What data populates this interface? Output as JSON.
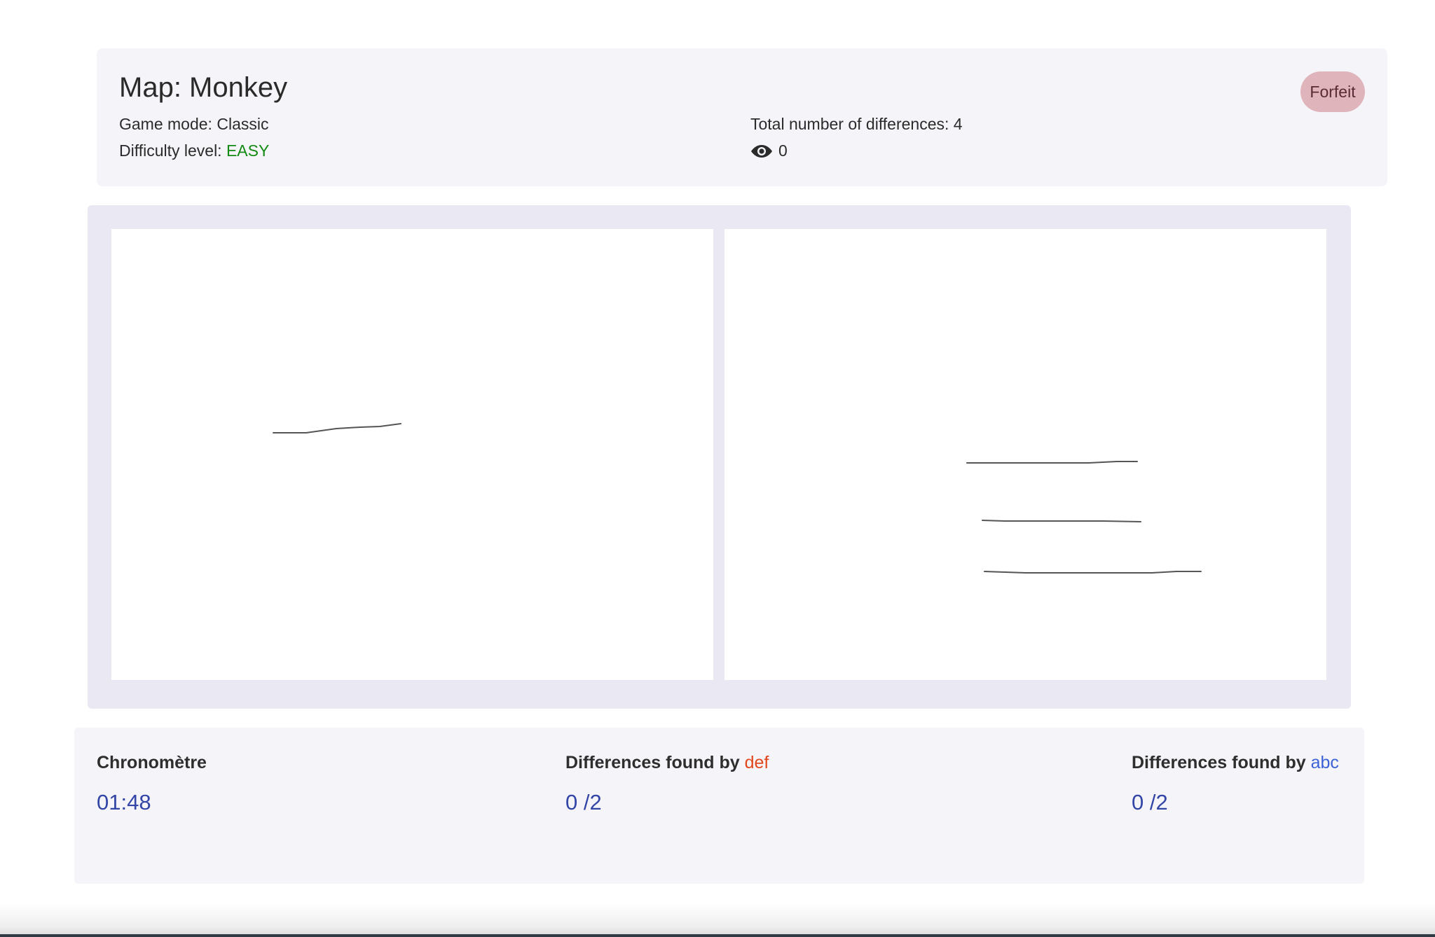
{
  "header": {
    "map_title": "Map: Monkey",
    "game_mode_label": "Game mode: ",
    "game_mode_value": "Classic",
    "difficulty_label": "Difficulty level: ",
    "difficulty_value": "EASY",
    "total_differences_label": "Total number of differences: ",
    "total_differences_value": "4",
    "hint_icon": "eye-icon",
    "hint_count": "0",
    "forfeit_label": "Forfeit"
  },
  "colors": {
    "difficulty_easy": "#138a13",
    "player1": "#e2461c",
    "player2": "#3c63d6",
    "stat_value": "#3345a6",
    "forfeit_bg": "#e0b4bb"
  },
  "footer": {
    "timer_label": "Chronomètre",
    "timer_value": "01:48",
    "player1_prefix": "Differences found by ",
    "player1_name": "def",
    "player1_score": "0 /2",
    "player2_prefix": "Differences found by ",
    "player2_name": "abc",
    "player2_score": "0 /2"
  }
}
